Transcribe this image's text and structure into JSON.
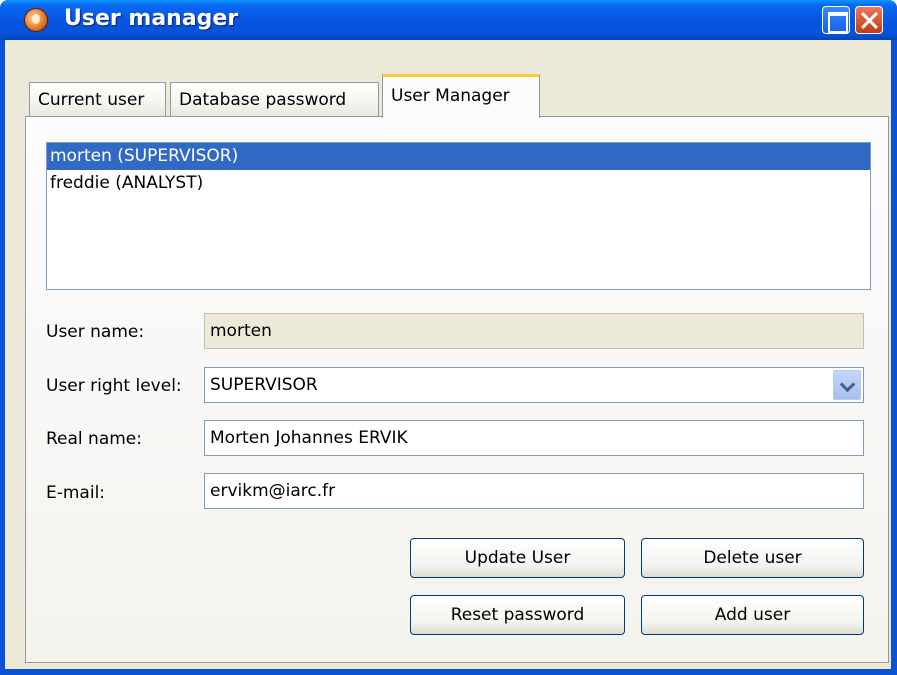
{
  "window": {
    "title": "User manager"
  },
  "tabs": [
    {
      "label": "Current user"
    },
    {
      "label": "Database password"
    },
    {
      "label": "User Manager",
      "active": true
    }
  ],
  "users": {
    "items": [
      {
        "label": "morten (SUPERVISOR)",
        "selected": true
      },
      {
        "label": "freddie (ANALYST)",
        "selected": false
      }
    ]
  },
  "form": {
    "user_name_label": "User name:",
    "user_name_value": "morten",
    "right_level_label": "User right level:",
    "right_level_value": "SUPERVISOR",
    "real_name_label": "Real name:",
    "real_name_value": "Morten Johannes ERVIK",
    "email_label": "E-mail:",
    "email_value": "ervikm@iarc.fr"
  },
  "buttons": {
    "update": "Update User",
    "delete": "Delete user",
    "reset": "Reset password",
    "add": "Add user"
  },
  "colors": {
    "titlebar": "#0654d8",
    "selection": "#316ac5",
    "dialog_bg": "#ece9d8",
    "active_tab_accent": "#ffc83c"
  }
}
